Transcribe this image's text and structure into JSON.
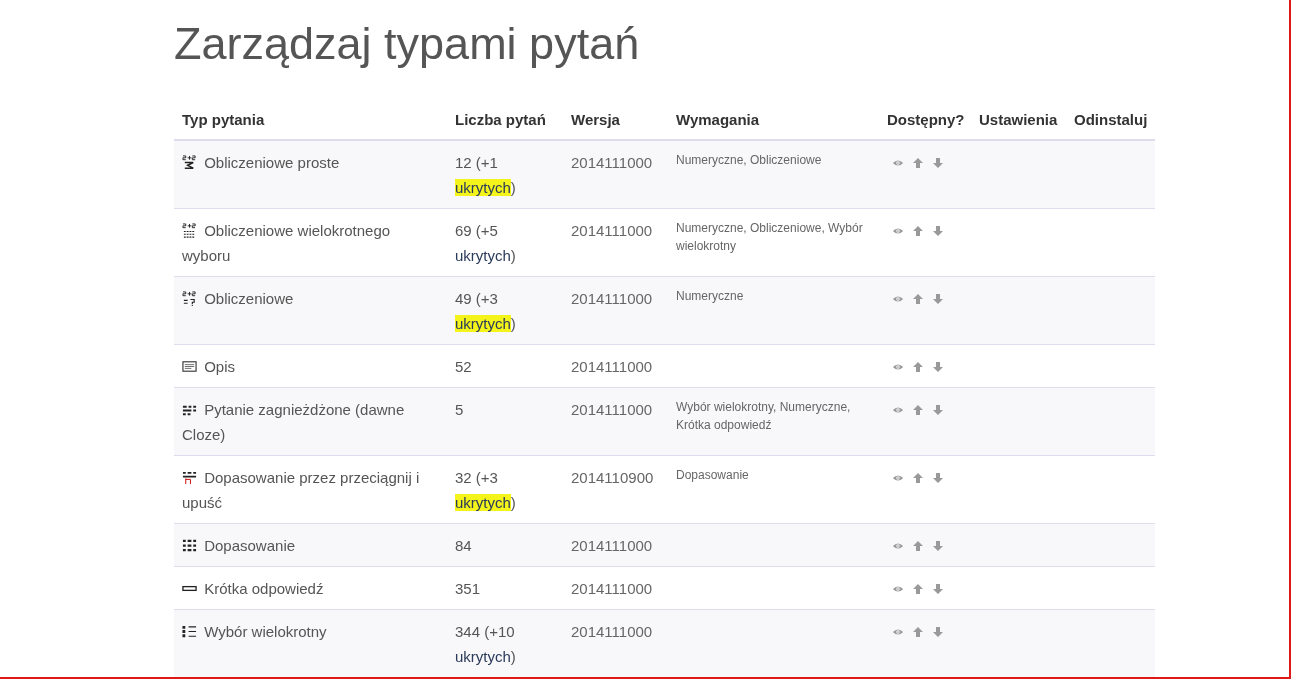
{
  "page_title": "Zarządzaj typami pytań",
  "table": {
    "columns": [
      "Typ pytania",
      "Liczba pytań",
      "Wersja",
      "Wymagania",
      "Dostępny?",
      "Ustawienia",
      "Odinstaluj"
    ],
    "rows": [
      {
        "name": "Obliczeniowe proste",
        "count": "12 (+1",
        "hidden_link": "ukrytych",
        "count_end": ")",
        "highlighted": true,
        "version": "2014111000",
        "requirements": "Numeryczne, Obliczeniowe"
      },
      {
        "name": "Obliczeniowe wielokrotnego wyboru",
        "count": "69 (+5",
        "hidden_link": "ukrytych",
        "count_end": ")",
        "highlighted": false,
        "version": "2014111000",
        "requirements": "Numeryczne, Obliczeniowe, Wybór wielokrotny"
      },
      {
        "name": "Obliczeniowe",
        "count": "49 (+3",
        "hidden_link": "ukrytych",
        "count_end": ")",
        "highlighted": true,
        "version": "2014111000",
        "requirements": "Numeryczne"
      },
      {
        "name": "Opis",
        "count": "52",
        "version": "2014111000"
      },
      {
        "name": "Pytanie zagnieżdżone (dawne Cloze)",
        "count": "5",
        "version": "2014111000",
        "requirements": "Wybór wielokrotny, Numeryczne, Krótka odpowiedź"
      },
      {
        "name": "Dopasowanie przez przeciągnij i upuść",
        "count": "32 (+3",
        "hidden_link": "ukrytych",
        "count_end": ")",
        "highlighted": true,
        "version": "2014110900",
        "requirements": "Dopasowanie"
      },
      {
        "name": "Dopasowanie",
        "count": "84",
        "version": "2014111000"
      },
      {
        "name": "Krótka odpowiedź",
        "count": "351",
        "version": "2014111000"
      },
      {
        "name": "Wybór wielokrotny",
        "count": "344 (+10",
        "hidden_link": "ukrytych",
        "count_end": ")",
        "highlighted": false,
        "version": "2014111000"
      }
    ]
  }
}
